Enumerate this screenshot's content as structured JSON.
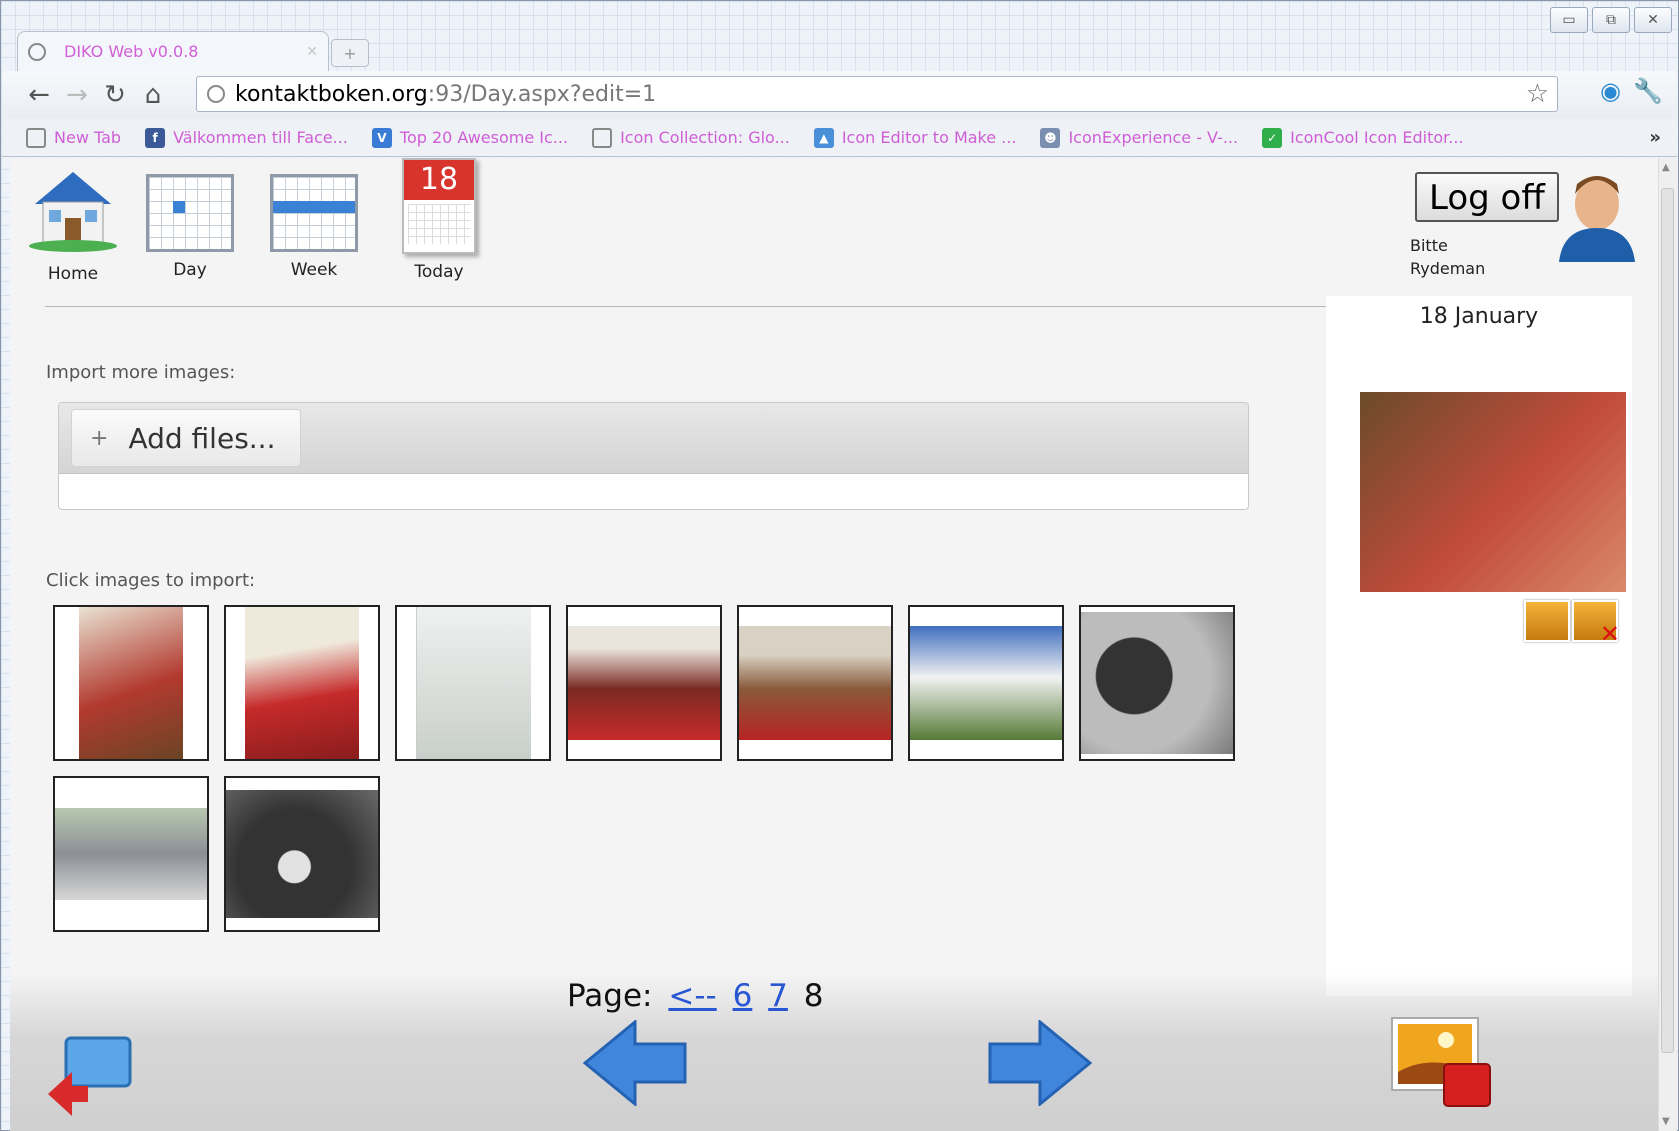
{
  "browser": {
    "tab_title": "DIKO Web v0.0.8",
    "url_host": "kontaktboken.org",
    "url_path": ":93/Day.aspx?edit=1",
    "bookmarks": [
      "New Tab",
      "Välkommen till Face...",
      "Top 20 Awesome Ic...",
      "Icon Collection: Glo...",
      "Icon Editor to Make ...",
      "IconExperience - V-...",
      "IconCool Icon Editor..."
    ],
    "bookmarks_more": "»"
  },
  "nav": {
    "home": "Home",
    "day": "Day",
    "week": "Week",
    "today": "Today",
    "today_number": "18"
  },
  "user": {
    "logoff_label": "Log off",
    "first_name": "Bitte",
    "last_name": "Rydeman"
  },
  "import": {
    "label": "Import more images:",
    "add_files": "Add files..."
  },
  "gallery": {
    "label": "Click images to import:",
    "images": [
      "photo-1",
      "photo-2",
      "photo-3",
      "photo-4",
      "photo-5",
      "photo-6",
      "photo-7",
      "photo-8",
      "photo-9"
    ]
  },
  "day_panel": {
    "date": "18 January"
  },
  "pager": {
    "label": "Page:",
    "prev": "<--",
    "pages": [
      "6",
      "7"
    ],
    "current": "8"
  },
  "colors": {
    "link": "#2957d4",
    "tab_text": "#d25fd8",
    "page_bg": "#f4f4f4"
  }
}
